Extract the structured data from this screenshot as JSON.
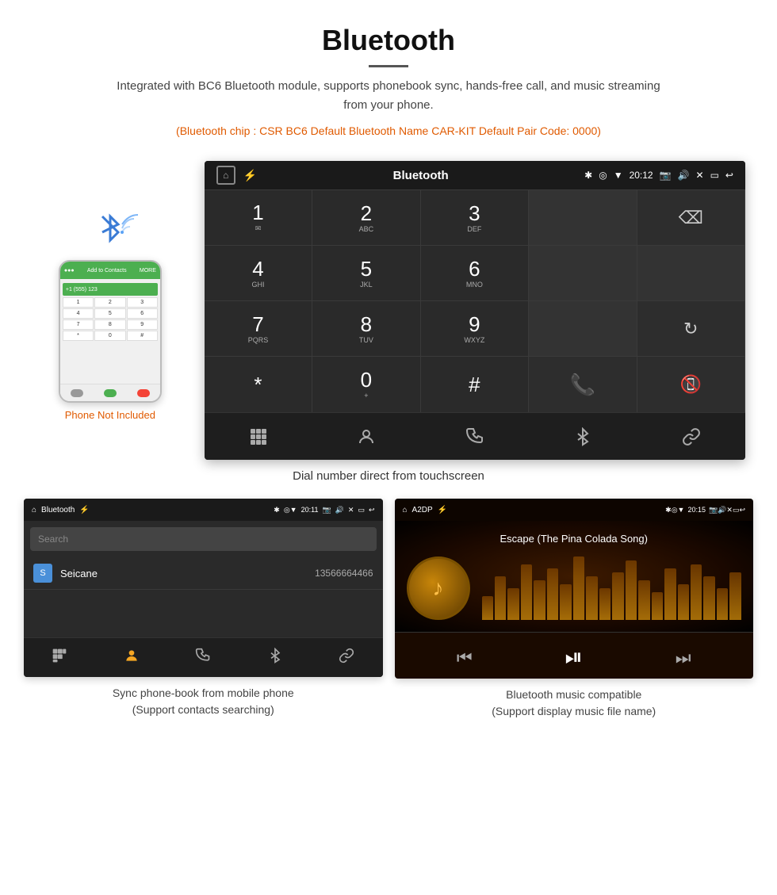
{
  "header": {
    "title": "Bluetooth",
    "description": "Integrated with BC6 Bluetooth module, supports phonebook sync, hands-free call, and music streaming from your phone.",
    "specs": "(Bluetooth chip : CSR BC6   Default Bluetooth Name CAR-KIT    Default Pair Code: 0000)"
  },
  "phone_side": {
    "not_included_label": "Phone Not Included"
  },
  "main_screen": {
    "title": "Bluetooth",
    "status_time": "20:12",
    "caption": "Dial number direct from touchscreen",
    "dialpad": [
      {
        "num": "1",
        "sub": "✉"
      },
      {
        "num": "2",
        "sub": "ABC"
      },
      {
        "num": "3",
        "sub": "DEF"
      },
      {
        "num": "",
        "sub": ""
      },
      {
        "num": "⌫",
        "sub": ""
      },
      {
        "num": "4",
        "sub": "GHI"
      },
      {
        "num": "5",
        "sub": "JKL"
      },
      {
        "num": "6",
        "sub": "MNO"
      },
      {
        "num": "",
        "sub": ""
      },
      {
        "num": "",
        "sub": ""
      },
      {
        "num": "7",
        "sub": "PQRS"
      },
      {
        "num": "8",
        "sub": "TUV"
      },
      {
        "num": "9",
        "sub": "WXYZ"
      },
      {
        "num": "",
        "sub": ""
      },
      {
        "num": "↻",
        "sub": ""
      },
      {
        "num": "*",
        "sub": ""
      },
      {
        "num": "0",
        "sub": "+"
      },
      {
        "num": "#",
        "sub": ""
      },
      {
        "num": "📞",
        "sub": "call_green"
      },
      {
        "num": "📵",
        "sub": "call_red"
      }
    ],
    "nav_icons": [
      "grid",
      "person",
      "phone",
      "bluetooth",
      "link"
    ]
  },
  "phonebook_screen": {
    "title": "Bluetooth",
    "status_time": "20:11",
    "search_placeholder": "Search",
    "contacts": [
      {
        "initial": "S",
        "name": "Seicane",
        "phone": "13566664466"
      }
    ],
    "caption": "Sync phone-book from mobile phone\n(Support contacts searching)"
  },
  "music_screen": {
    "title": "A2DP",
    "status_time": "20:15",
    "song_title": "Escape (The Pina Colada Song)",
    "eq_bars": [
      30,
      55,
      40,
      70,
      50,
      65,
      45,
      80,
      55,
      40,
      60,
      75,
      50,
      35,
      65,
      45,
      70,
      55,
      40,
      60
    ],
    "caption": "Bluetooth music compatible\n(Support display music file name)"
  }
}
